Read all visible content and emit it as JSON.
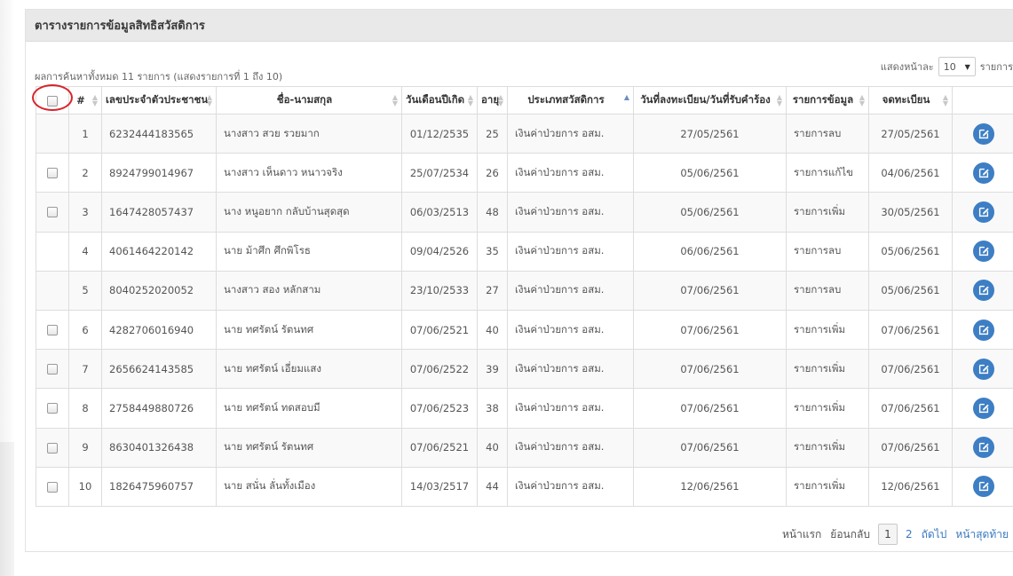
{
  "panel": {
    "title": "ตารางรายการข้อมูลสิทธิสวัสดิการ"
  },
  "info": "ผลการค้นหาทั้งหมด 11 รายการ (แสดงรายการที่ 1 ถึง 10)",
  "length": {
    "label_before": "แสดงหน้าละ",
    "value": "10",
    "label_after": "รายการ"
  },
  "columns": [
    {
      "key": "select",
      "label": ""
    },
    {
      "key": "no",
      "label": "#"
    },
    {
      "key": "id",
      "label": "เลขประจำตัวประชาชน"
    },
    {
      "key": "name",
      "label": "ชื่อ-นามสกุล"
    },
    {
      "key": "birth",
      "label": "วันเดือนปีเกิด"
    },
    {
      "key": "age",
      "label": "อายุ"
    },
    {
      "key": "type",
      "label": "ประเภทสวัสดิการ"
    },
    {
      "key": "regdate",
      "label": "วันที่ลงทะเบียน/วันที่รับคำร้อง"
    },
    {
      "key": "item",
      "label": "รายการข้อมูล"
    },
    {
      "key": "recdate",
      "label": "จดทะเบียน"
    },
    {
      "key": "action",
      "label": ""
    }
  ],
  "rows": [
    {
      "checkbox": false,
      "no": "1",
      "id": "6232444183565",
      "name": "นางสาว สวย รวยมาก",
      "birth": "01/12/2535",
      "age": "25",
      "type": "เงินค่าป่วยการ อสม.",
      "regdate": "27/05/2561",
      "item": "รายการลบ",
      "recdate": "27/05/2561"
    },
    {
      "checkbox": true,
      "no": "2",
      "id": "8924799014967",
      "name": "นางสาว เห็นดาว หนาวจริง",
      "birth": "25/07/2534",
      "age": "26",
      "type": "เงินค่าป่วยการ อสม.",
      "regdate": "05/06/2561",
      "item": "รายการแก้ไข",
      "recdate": "04/06/2561"
    },
    {
      "checkbox": true,
      "no": "3",
      "id": "1647428057437",
      "name": "นาง หนูอยาก กลับบ้านสุดสุด",
      "birth": "06/03/2513",
      "age": "48",
      "type": "เงินค่าป่วยการ อสม.",
      "regdate": "05/06/2561",
      "item": "รายการเพิ่ม",
      "recdate": "30/05/2561"
    },
    {
      "checkbox": false,
      "no": "4",
      "id": "4061464220142",
      "name": "นาย ม้าศึก ศึกพิโรธ",
      "birth": "09/04/2526",
      "age": "35",
      "type": "เงินค่าป่วยการ อสม.",
      "regdate": "06/06/2561",
      "item": "รายการลบ",
      "recdate": "05/06/2561"
    },
    {
      "checkbox": false,
      "no": "5",
      "id": "8040252020052",
      "name": "นางสาว สอง หลักสาม",
      "birth": "23/10/2533",
      "age": "27",
      "type": "เงินค่าป่วยการ อสม.",
      "regdate": "07/06/2561",
      "item": "รายการลบ",
      "recdate": "05/06/2561"
    },
    {
      "checkbox": true,
      "no": "6",
      "id": "4282706016940",
      "name": "นาย ทศรัตน์ รัตนทศ",
      "birth": "07/06/2521",
      "age": "40",
      "type": "เงินค่าป่วยการ อสม.",
      "regdate": "07/06/2561",
      "item": "รายการเพิ่ม",
      "recdate": "07/06/2561"
    },
    {
      "checkbox": true,
      "no": "7",
      "id": "2656624143585",
      "name": "นาย ทศรัตน์ เอี่ยมแสง",
      "birth": "07/06/2522",
      "age": "39",
      "type": "เงินค่าป่วยการ อสม.",
      "regdate": "07/06/2561",
      "item": "รายการเพิ่ม",
      "recdate": "07/06/2561"
    },
    {
      "checkbox": true,
      "no": "8",
      "id": "2758449880726",
      "name": "นาย ทศรัตน์ ทดสอบมี",
      "birth": "07/06/2523",
      "age": "38",
      "type": "เงินค่าป่วยการ อสม.",
      "regdate": "07/06/2561",
      "item": "รายการเพิ่ม",
      "recdate": "07/06/2561"
    },
    {
      "checkbox": true,
      "no": "9",
      "id": "8630401326438",
      "name": "นาย ทศรัตน์ รัตนทศ",
      "birth": "07/06/2521",
      "age": "40",
      "type": "เงินค่าป่วยการ อสม.",
      "regdate": "07/06/2561",
      "item": "รายการเพิ่ม",
      "recdate": "07/06/2561"
    },
    {
      "checkbox": true,
      "no": "10",
      "id": "1826475960757",
      "name": "นาย สนั่น ลั่นทั้งเมือง",
      "birth": "14/03/2517",
      "age": "44",
      "type": "เงินค่าป่วยการ อสม.",
      "regdate": "12/06/2561",
      "item": "รายการเพิ่ม",
      "recdate": "12/06/2561"
    }
  ],
  "pagination": {
    "first": "หน้าแรก",
    "prev": "ย้อนกลับ",
    "pages": [
      "1",
      "2"
    ],
    "current": "1",
    "next": "ถัดไป",
    "last": "หน้าสุดท้าย"
  },
  "icons": {
    "edit": "edit-pencil-icon",
    "sort": "sort-arrows-icon",
    "dropdown": "caret-down-icon"
  },
  "colors": {
    "edit_button": "#3d7ec4",
    "highlight_ring": "#d8242c",
    "link": "#3a78c2"
  }
}
